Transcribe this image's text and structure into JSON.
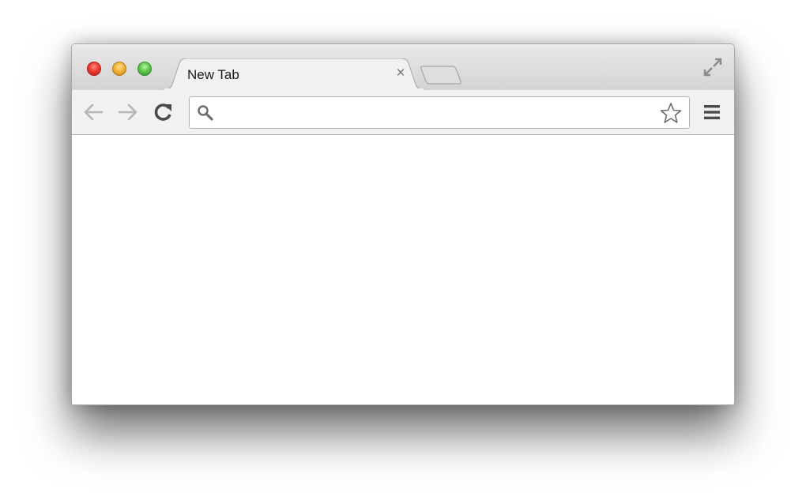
{
  "browser": {
    "tabs": [
      {
        "title": "New Tab",
        "active": true,
        "close_glyph": "×"
      }
    ],
    "new_tab_icon": "new-tab-icon",
    "fullscreen_icon": "fullscreen-icon"
  },
  "toolbar": {
    "back_icon": "back-arrow-icon",
    "forward_icon": "forward-arrow-icon",
    "reload_icon": "reload-icon",
    "omnibox": {
      "value": "",
      "placeholder": ""
    },
    "search_icon": "search-icon",
    "bookmark_icon": "star-icon",
    "menu_icon": "hamburger-menu-icon"
  },
  "colors": {
    "close_button": "#ee3b33",
    "minimize_button": "#f4b33b",
    "zoom_button": "#5fc94c",
    "titlebar": "#dcdcdc",
    "toolbar": "#f1f1f1"
  }
}
